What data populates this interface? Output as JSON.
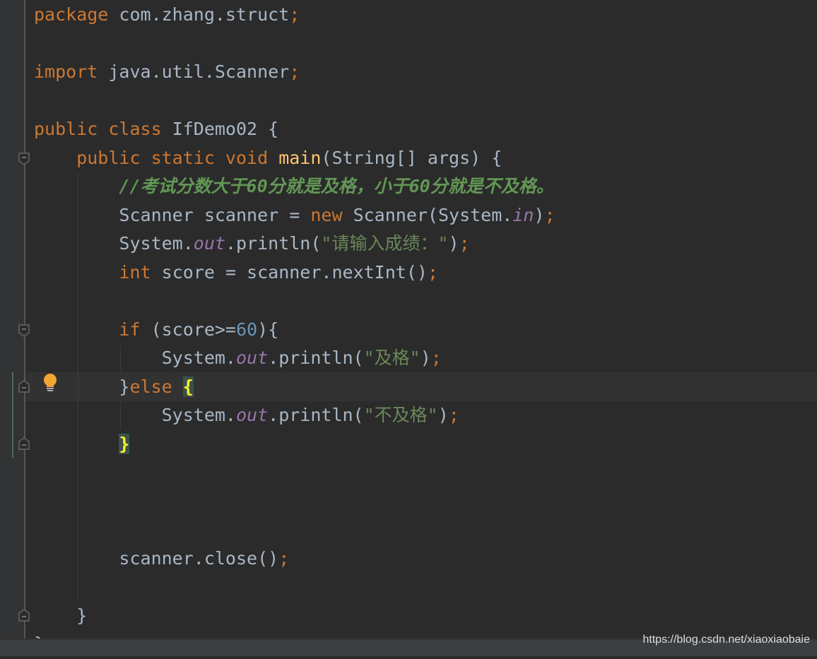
{
  "editor": {
    "lines": [
      [
        [
          "package ",
          "kw"
        ],
        [
          "com.zhang.struct",
          "tx"
        ],
        [
          ";",
          "kw"
        ]
      ],
      [],
      [
        [
          "import ",
          "kw"
        ],
        [
          "java.util.Scanner",
          "tx"
        ],
        [
          ";",
          "kw"
        ]
      ],
      [],
      [
        [
          "public class ",
          "kw"
        ],
        [
          "IfDemo02 {",
          "tx"
        ]
      ],
      [
        [
          "    public static void ",
          "kw"
        ],
        [
          "main",
          "fn"
        ],
        [
          "(String[] args) {",
          "tx"
        ]
      ],
      [
        [
          "        //考试分数大于60分就是及格，小于60分就是不及格。",
          "cm"
        ]
      ],
      [
        [
          "        Scanner scanner = ",
          "tx"
        ],
        [
          "new ",
          "kw"
        ],
        [
          "Scanner(System.",
          "tx"
        ],
        [
          "in",
          "sf"
        ],
        [
          ")",
          "tx"
        ],
        [
          ";",
          "kw"
        ]
      ],
      [
        [
          "        System.",
          "tx"
        ],
        [
          "out",
          "sf"
        ],
        [
          ".println(",
          "tx"
        ],
        [
          "\"请输入成绩：\"",
          "st"
        ],
        [
          ")",
          "tx"
        ],
        [
          ";",
          "kw"
        ]
      ],
      [
        [
          "        ",
          "tx"
        ],
        [
          "int ",
          "kw"
        ],
        [
          "score = scanner.nextInt()",
          "tx"
        ],
        [
          ";",
          "kw"
        ]
      ],
      [],
      [
        [
          "        ",
          "tx"
        ],
        [
          "if ",
          "kw"
        ],
        [
          "(score>=",
          "tx"
        ],
        [
          "60",
          "nm"
        ],
        [
          "){",
          "tx"
        ]
      ],
      [
        [
          "            System.",
          "tx"
        ],
        [
          "out",
          "sf"
        ],
        [
          ".println(",
          "tx"
        ],
        [
          "\"及格\"",
          "st"
        ],
        [
          ")",
          "tx"
        ],
        [
          ";",
          "kw"
        ]
      ],
      [
        [
          "        }",
          "tx"
        ],
        [
          "else ",
          "kw"
        ],
        [
          "{",
          "br"
        ]
      ],
      [
        [
          "            System.",
          "tx"
        ],
        [
          "out",
          "sf"
        ],
        [
          ".println(",
          "tx"
        ],
        [
          "\"不及格\"",
          "st"
        ],
        [
          ")",
          "tx"
        ],
        [
          ";",
          "kw"
        ]
      ],
      [
        [
          "        ",
          "tx"
        ],
        [
          "}",
          "br"
        ]
      ],
      [],
      [],
      [],
      [
        [
          "        scanner.close()",
          "tx"
        ],
        [
          ";",
          "kw"
        ]
      ],
      [],
      [
        [
          "    }",
          "tx"
        ]
      ],
      [
        [
          "}",
          "tx"
        ]
      ]
    ],
    "colors": {
      "keyword": "#cc7832",
      "text": "#a9b7c6",
      "comment": "#629755",
      "string": "#6a8759",
      "number": "#6897bb",
      "static_field": "#9876aa",
      "method": "#ffc66d",
      "background": "#2b2b2b"
    },
    "intention_icon": "lightbulb-icon"
  },
  "watermark": "https://blog.csdn.net/xiaoxiaobaie"
}
